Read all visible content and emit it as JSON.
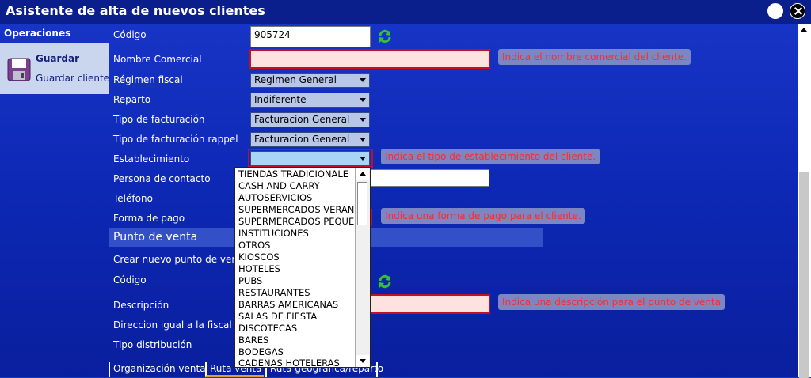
{
  "window": {
    "title": "Asistente de alta de nuevos clientes"
  },
  "sidebar": {
    "header": "Operaciones",
    "save_label": "Guardar",
    "save_client_label": "Guardar cliente"
  },
  "form": {
    "codigo_label": "Código",
    "codigo_value": "905724",
    "nombre_comercial_label": "Nombre Comercial",
    "regimen_fiscal_label": "Régimen fiscal",
    "regimen_fiscal_value": "Regimen General",
    "reparto_label": "Reparto",
    "reparto_value": "Indiferente",
    "tipo_facturacion_label": "Tipo de facturación",
    "tipo_facturacion_value": "Facturacion General",
    "tipo_facturacion_rappel_label": "Tipo de facturación rappel",
    "tipo_facturacion_rappel_value": "Facturacion General",
    "establecimiento_label": "Establecimiento",
    "persona_contacto_label": "Persona de contacto",
    "telefono_label": "Teléfono",
    "forma_pago_label": "Forma de pago"
  },
  "tooltips": {
    "nombre_comercial": "Indica el nombre comercial del cliente.",
    "establecimiento": "Indica el tipo de establecimiento del cliente.",
    "forma_pago": "Indica una forma de pago para el cliente.",
    "descripcion": "Indica una descripción para el punto de venta"
  },
  "punto_venta": {
    "title": "Punto de venta",
    "crear_label": "Crear nuevo punto de venta",
    "codigo_label": "Código",
    "descripcion_label": "Descripción",
    "direccion_label": "Direccion igual a la fiscal",
    "tipo_distribucion_label": "Tipo distribución"
  },
  "dropdown": {
    "options": [
      "TIENDAS TRADICIONALE",
      "CASH AND CARRY",
      "AUTOSERVICIOS",
      "SUPERMERCADOS VERANO",
      "SUPERMERCADOS PEQUE¤",
      "INSTITUCIONES",
      "OTROS",
      "KIOSCOS",
      "HOTELES",
      "PUBS",
      "RESTAURANTES",
      "BARRAS AMERICANAS",
      "SALAS DE FIESTA",
      "DISCOTECAS",
      "BARES",
      "BODEGAS",
      "CADENAS HOTELERAS"
    ]
  },
  "tabs": [
    "Organización venta",
    "Ruta venta",
    "Ruta geográfica/reparto"
  ],
  "colors": {
    "background": "#1230c0",
    "error_border": "#c01028",
    "tooltip_bg": "#7b86c2",
    "tooltip_text": "#ff2a2a"
  }
}
